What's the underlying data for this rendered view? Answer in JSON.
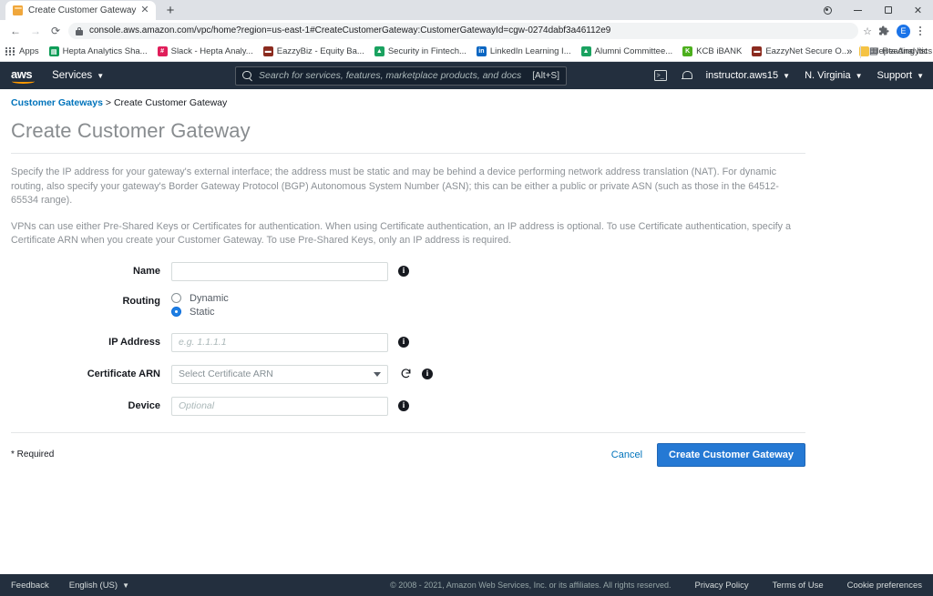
{
  "browser": {
    "tab": {
      "title": "Create Customer Gateway | VPC",
      "favicon": "vpc-cube-icon",
      "close_label": "✕"
    },
    "newtab_label": "+",
    "nav": {
      "back": "←",
      "forward": "→",
      "reload": "⟳"
    },
    "url": "console.aws.amazon.com/vpc/home?region=us-east-1#CreateCustomerGateway:CustomerGatewayId=cgw-0274dabf3a46112e9",
    "url_domain": "console.aws.amazon.com",
    "url_path": "/vpc/home?region=us-east-1#CreateCustomerGateway:CustomerGatewayId=cgw-0274dabf3a46112e9",
    "star_label": "☆",
    "avatar_letter": "E",
    "bookmarks": [
      {
        "label": "Apps",
        "icon": "apps-grid-icon",
        "color": "#5f6368"
      },
      {
        "label": "Hepta Analytics Sha...",
        "icon": "sheets-icon",
        "color": "#0f9d58"
      },
      {
        "label": "Slack - Hepta Analy...",
        "icon": "slack-icon",
        "color": "#e01e5a"
      },
      {
        "label": "EazzyBiz - Equity Ba...",
        "icon": "bank-icon",
        "color": "#8b2b1f"
      },
      {
        "label": "Security in Fintech...",
        "icon": "drive-icon",
        "color": "#1aa260"
      },
      {
        "label": "LinkedIn Learning I...",
        "icon": "linkedin-icon",
        "color": "#0a66c2"
      },
      {
        "label": "Alumni Committee...",
        "icon": "drive-icon",
        "color": "#1aa260"
      },
      {
        "label": "KCB iBANK",
        "icon": "kcb-icon",
        "color": "#4caf1d"
      },
      {
        "label": "EazzyNet Secure O...",
        "icon": "bank-icon",
        "color": "#8b2b1f"
      },
      {
        "label": "Hepta Analytics",
        "icon": "folder-icon",
        "color": "#f5c344"
      }
    ],
    "bookmarks_overflow": "»",
    "reading_list": "Reading list"
  },
  "aws_nav": {
    "logo": "aws",
    "services_label": "Services",
    "search_placeholder": "Search for services, features, marketplace products, and docs",
    "search_shortcut": "[Alt+S]",
    "cloudshell_icon": "cloudshell-icon",
    "bell_icon": "notifications-bell-icon",
    "account": "instructor.aws15",
    "region": "N. Virginia",
    "support": "Support"
  },
  "breadcrumb": {
    "parent": "Customer Gateways",
    "separator": ">",
    "current": "Create Customer Gateway"
  },
  "page": {
    "title": "Create Customer Gateway",
    "paragraph1": "Specify the IP address for your gateway's external interface; the address must be static and may be behind a device performing network address translation (NAT). For dynamic routing, also specify your gateway's Border Gateway Protocol (BGP) Autonomous System Number (ASN); this can be either a public or private ASN (such as those in the 64512-65534 range).",
    "paragraph2": "VPNs can use either Pre-Shared Keys or Certificates for authentication. When using Certificate authentication, an IP address is optional. To use Certificate authentication, specify a Certificate ARN when you create your Customer Gateway. To use Pre-Shared Keys, only an IP address is required."
  },
  "form": {
    "name": {
      "label": "Name",
      "value": "",
      "placeholder": "",
      "info": "i"
    },
    "routing": {
      "label": "Routing",
      "options": [
        {
          "label": "Dynamic",
          "selected": false
        },
        {
          "label": "Static",
          "selected": true
        }
      ]
    },
    "ip_address": {
      "label": "IP Address",
      "value": "",
      "placeholder": "e.g. 1.1.1.1",
      "info": "i"
    },
    "certificate_arn": {
      "label": "Certificate ARN",
      "value": "Select Certificate ARN",
      "refresh_icon": "refresh-icon",
      "info": "i"
    },
    "device": {
      "label": "Device",
      "value": "",
      "placeholder": "Optional",
      "info": "i"
    }
  },
  "footer_actions": {
    "required_note": "* Required",
    "cancel_label": "Cancel",
    "submit_label": "Create Customer Gateway",
    "primary_color": "#2579d4"
  },
  "aws_footer": {
    "feedback": "Feedback",
    "language": "English (US)",
    "copyright": "© 2008 - 2021, Amazon Web Services, Inc. or its affiliates. All rights reserved.",
    "privacy": "Privacy Policy",
    "terms": "Terms of Use",
    "cookies": "Cookie preferences"
  }
}
